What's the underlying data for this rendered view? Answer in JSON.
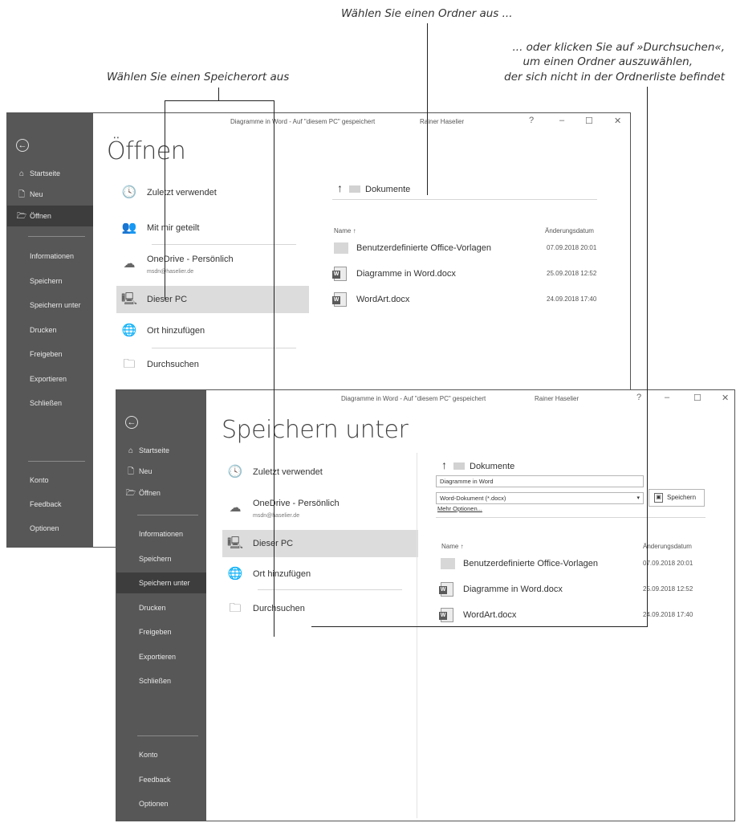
{
  "callouts": {
    "folder": "Wählen Sie einen Ordner aus ...",
    "browse_1": "... oder klicken Sie auf »Durchsuchen«,",
    "browse_2": "um einen Ordner auszuwählen,",
    "browse_3": "der sich nicht in der Ordnerliste befindet",
    "location": "Wählen Sie einen Speicherort aus"
  },
  "window_open": {
    "title": "Diagramme in Word  -  Auf \"diesem PC\" gespeichert",
    "user": "Rainer Haselier",
    "help": "?",
    "minimize": "–",
    "maximize": "☐",
    "close": "✕",
    "page_title": "Öffnen",
    "sidebar": {
      "back": "←",
      "top": [
        {
          "icon": "⌂",
          "label": "Startseite"
        },
        {
          "icon": "🗋",
          "label": "Neu"
        },
        {
          "icon": "🗁",
          "label": "Öffnen"
        }
      ],
      "sub": [
        "Informationen",
        "Speichern",
        "Speichern unter",
        "Drucken",
        "Freigeben",
        "Exportieren",
        "Schließen"
      ],
      "bottom": [
        "Konto",
        "Feedback",
        "Optionen"
      ]
    },
    "locations": [
      {
        "icon": "🕓",
        "label": "Zuletzt verwendet"
      },
      {
        "icon": "👥",
        "label": "Mit mir geteilt"
      },
      {
        "icon": "☁",
        "label": "OneDrive - Persönlich",
        "sub": "msdn@haselier.de"
      },
      {
        "icon": "🖳",
        "label": "Dieser PC"
      },
      {
        "icon": "🌐",
        "label": "Ort hinzufügen"
      },
      {
        "icon": "🗀",
        "label": "Durchsuchen"
      }
    ],
    "breadcrumb": "Dokumente",
    "breadcrumb_arrow": "↑",
    "col_name": "Name ↑",
    "col_date": "Änderungsdatum",
    "files": [
      {
        "name": "Benutzerdefinierte Office-Vorlagen",
        "date": "07.09.2018 20:01"
      },
      {
        "name": "Diagramme in Word.docx",
        "date": "25.09.2018 12:52"
      },
      {
        "name": "WordArt.docx",
        "date": "24.09.2018 17:40"
      }
    ]
  },
  "window_save": {
    "title": "Diagramme in Word  -  Auf \"diesem PC\" gespeichert",
    "user": "Rainer Haselier",
    "help": "?",
    "minimize": "–",
    "maximize": "☐",
    "close": "✕",
    "page_title": "Speichern unter",
    "sidebar": {
      "back": "←",
      "top": [
        {
          "icon": "⌂",
          "label": "Startseite"
        },
        {
          "icon": "🗋",
          "label": "Neu"
        },
        {
          "icon": "🗁",
          "label": "Öffnen"
        }
      ],
      "sub": [
        "Informationen",
        "Speichern",
        "Speichern unter",
        "Drucken",
        "Freigeben",
        "Exportieren",
        "Schließen"
      ],
      "bottom": [
        "Konto",
        "Feedback",
        "Optionen"
      ]
    },
    "locations": [
      {
        "icon": "🕓",
        "label": "Zuletzt verwendet"
      },
      {
        "icon": "☁",
        "label": "OneDrive - Persönlich",
        "sub": "msdn@haselier.de"
      },
      {
        "icon": "🖳",
        "label": "Dieser PC"
      },
      {
        "icon": "🌐",
        "label": "Ort hinzufügen"
      },
      {
        "icon": "🗀",
        "label": "Durchsuchen"
      }
    ],
    "breadcrumb": "Dokumente",
    "breadcrumb_arrow": "↑",
    "filename": "Diagramme in Word",
    "filetype": "Word-Dokument (*.docx)",
    "filetype_arrow": "▾",
    "save_button": "Speichern",
    "more_options": "Mehr Optionen...",
    "col_name": "Name ↑",
    "col_date": "Änderungsdatum",
    "files": [
      {
        "name": "Benutzerdefinierte Office-Vorlagen",
        "date": "07.09.2018 20:01"
      },
      {
        "name": "Diagramme in Word.docx",
        "date": "25.09.2018 12:52"
      },
      {
        "name": "WordArt.docx",
        "date": "24.09.2018 17:40"
      }
    ]
  }
}
